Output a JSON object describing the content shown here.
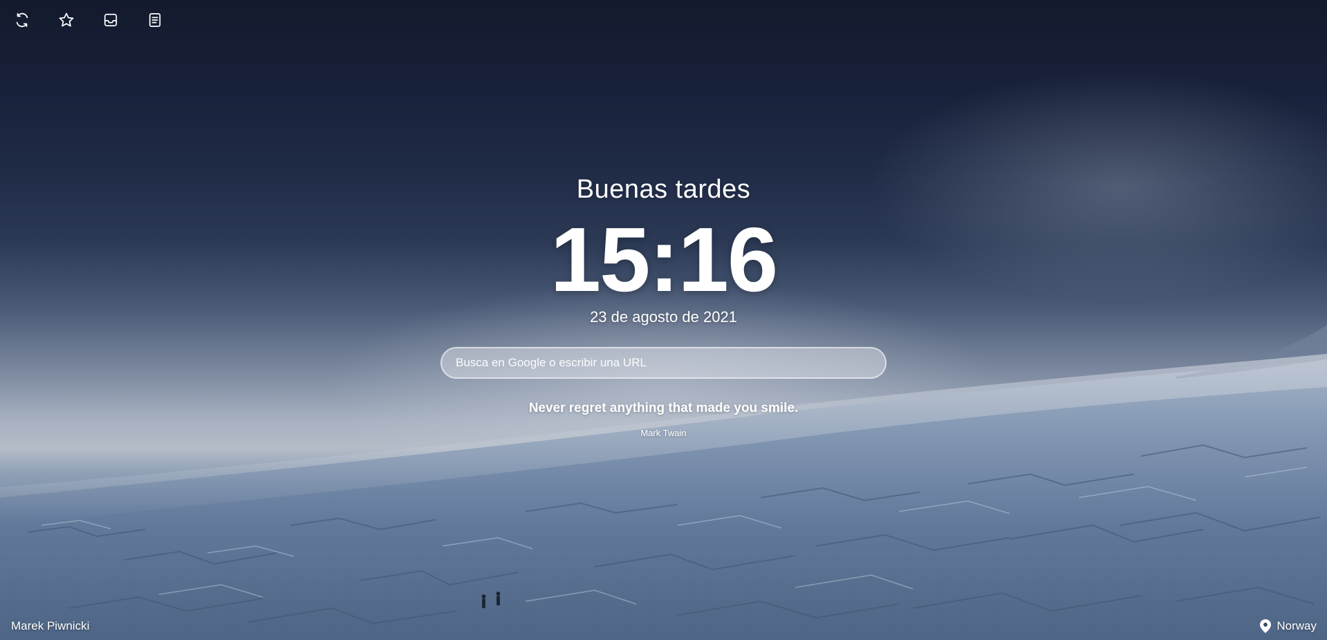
{
  "toolbar": {
    "buttons": [
      {
        "name": "refresh-background",
        "icon": "refresh-icon"
      },
      {
        "name": "favorites",
        "icon": "star-icon"
      },
      {
        "name": "inbox",
        "icon": "inbox-icon"
      },
      {
        "name": "notes",
        "icon": "notes-icon"
      }
    ]
  },
  "main": {
    "greeting": "Buenas tardes",
    "time": "15:16",
    "date": "23 de agosto de 2021",
    "search_placeholder": "Busca en Google o escribir una URL",
    "quote": "Never regret anything that made you smile.",
    "quote_author": "Mark Twain"
  },
  "footer": {
    "photo_credit": "Marek Piwnicki",
    "location": "Norway",
    "location_icon": "location-pin-icon"
  },
  "colors": {
    "text": "#ffffff",
    "sky_top": "#131a2d",
    "glacier": "#556c8a"
  }
}
